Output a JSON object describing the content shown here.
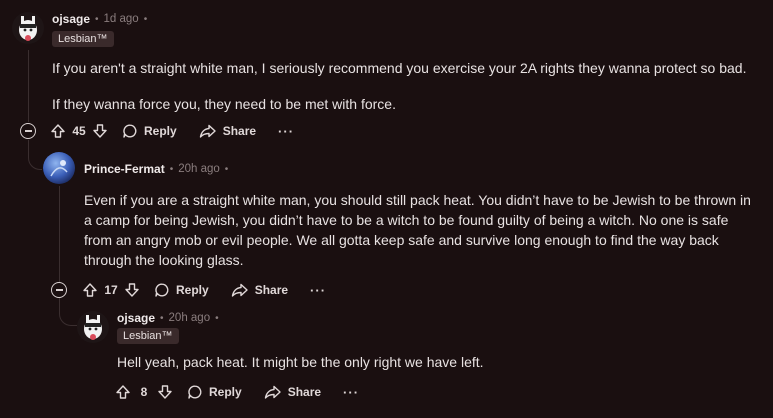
{
  "comments": [
    {
      "username": "ojsage",
      "time": "1d ago",
      "flair": "Lesbian™",
      "paragraphs": [
        "If you aren't a straight white man, I seriously recommend you exercise your 2A rights they wanna protect so bad.",
        "If they wanna force you, they need to be met with force."
      ],
      "votes": "45",
      "reply_label": "Reply",
      "share_label": "Share",
      "more_label": "···"
    },
    {
      "username": "Prince-Fermat",
      "time": "20h ago",
      "paragraphs": [
        "Even if you are a straight white man, you should still pack heat. You didn’t have to be Jewish to be thrown in a camp for being Jewish, you didn’t have to be a witch to be found guilty of being a witch. No one is safe from an angry mob or evil people. We all gotta keep safe and survive long enough to find the way back through the looking glass."
      ],
      "votes": "17",
      "reply_label": "Reply",
      "share_label": "Share",
      "more_label": "···"
    },
    {
      "username": "ojsage",
      "time": "20h ago",
      "flair": "Lesbian™",
      "paragraphs": [
        "Hell yeah, pack heat. It might be the only right we have left."
      ],
      "votes": "8",
      "reply_label": "Reply",
      "share_label": "Share",
      "more_label": "···"
    }
  ],
  "dot": "•",
  "colors": {
    "background": "#1a0f10",
    "flair_bg": "#3a2a2b",
    "muted": "#8a7d7e"
  },
  "icons": [
    "upvote-icon",
    "downvote-icon",
    "reply-bubble-icon",
    "share-arrow-icon",
    "collapse-icon",
    "avatar"
  ]
}
